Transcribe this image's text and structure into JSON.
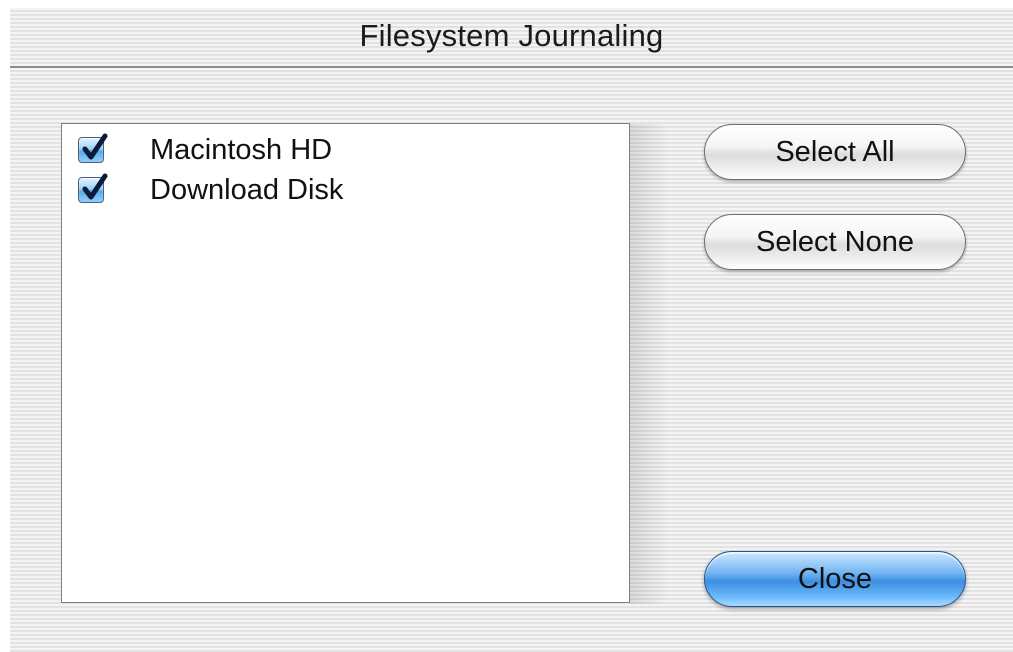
{
  "window": {
    "title": "Filesystem Journaling"
  },
  "volumes": [
    {
      "label": "Macintosh HD",
      "checked": true
    },
    {
      "label": "Download Disk",
      "checked": true
    }
  ],
  "buttons": {
    "select_all": "Select All",
    "select_none": "Select None",
    "close": "Close"
  },
  "colors": {
    "accent_blue": "#3e8fe2",
    "checkmark": "#0d1b3a",
    "list_background": "#ffffff"
  }
}
